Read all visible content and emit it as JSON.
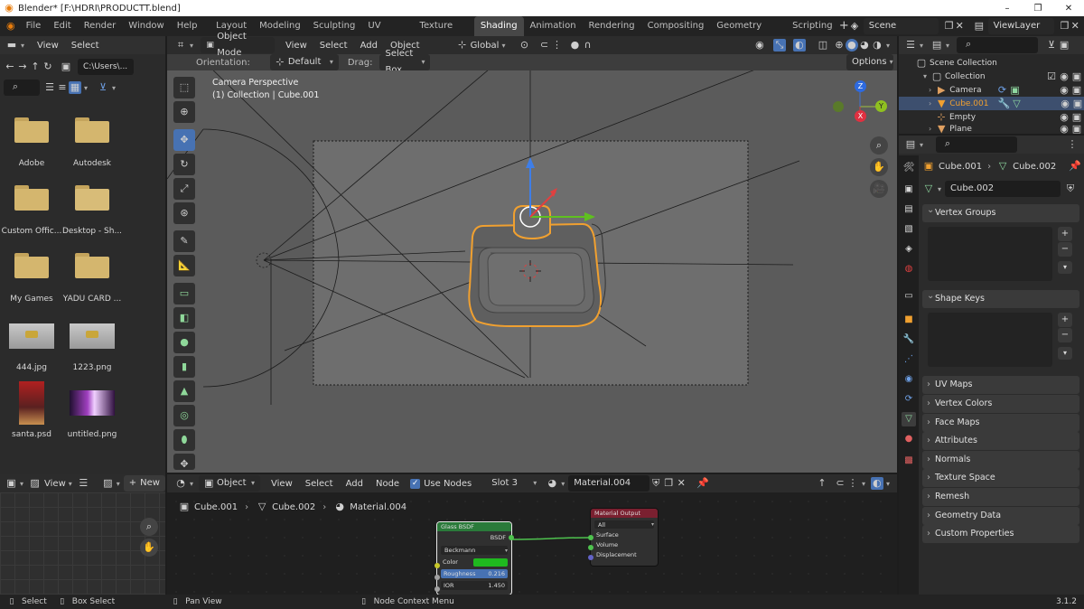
{
  "window": {
    "title": "Blender* [F:\\HDRI\\PRODUCTT.blend]",
    "controls": [
      "–",
      "❐",
      "✕"
    ]
  },
  "menu": [
    "File",
    "Edit",
    "Render",
    "Window",
    "Help"
  ],
  "workspaces": [
    "Layout",
    "Modeling",
    "Sculpting",
    "UV Editing",
    "Texture Paint",
    "Shading",
    "Animation",
    "Rendering",
    "Compositing",
    "Geometry Nodes",
    "Scripting"
  ],
  "active_workspace": "Shading",
  "scene": "Scene",
  "view_layer": "ViewLayer",
  "file_browser": {
    "menu": [
      "View",
      "Select"
    ],
    "path": "C:\\Users\\...",
    "items": [
      {
        "name": "Adobe",
        "type": "folder"
      },
      {
        "name": "Autodesk",
        "type": "folder"
      },
      {
        "name": "Custom Offic...",
        "type": "folder"
      },
      {
        "name": "Desktop - Sh...",
        "type": "folder"
      },
      {
        "name": "My Games",
        "type": "folder"
      },
      {
        "name": "YADU CARD ...",
        "type": "folder"
      },
      {
        "name": "444.jpg",
        "type": "image"
      },
      {
        "name": "1223.png",
        "type": "image"
      },
      {
        "name": "santa.psd",
        "type": "image"
      },
      {
        "name": "untitled.png",
        "type": "image"
      }
    ]
  },
  "viewport": {
    "mode": "Object Mode",
    "menu": [
      "View",
      "Select",
      "Add",
      "Object"
    ],
    "transform": "Global",
    "orientation_label": "Orientation:",
    "orientation_value": "Default",
    "drag_label": "Drag:",
    "drag_value": "Select Box",
    "options": "Options",
    "camera_text": "Camera Perspective",
    "collection_text": "(1) Collection | Cube.001",
    "gizmo": {
      "x": "X",
      "y": "Y",
      "z": "Z"
    }
  },
  "outliner": {
    "title": "Scene Collection",
    "items": [
      {
        "name": "Collection",
        "level": 1
      },
      {
        "name": "Camera",
        "level": 2
      },
      {
        "name": "Cube.001",
        "level": 2,
        "selected": true
      },
      {
        "name": "Empty",
        "level": 2
      },
      {
        "name": "Plane",
        "level": 2
      }
    ]
  },
  "properties": {
    "breadcrumb_obj": "Cube.001",
    "breadcrumb_data": "Cube.002",
    "data_name": "Cube.002",
    "open_panels": [
      "Vertex Groups",
      "Shape Keys"
    ],
    "panels": [
      "UV Maps",
      "Vertex Colors",
      "Face Maps",
      "Attributes",
      "Normals",
      "Texture Space",
      "Remesh",
      "Geometry Data",
      "Custom Properties"
    ]
  },
  "uv_editor": {
    "view": "View",
    "new": "New"
  },
  "node_editor": {
    "type": "Object",
    "menu": [
      "View",
      "Select",
      "Add",
      "Node"
    ],
    "use_nodes": "Use Nodes",
    "slot": "Slot 3",
    "material": "Material.004",
    "breadcrumb": [
      "Cube.001",
      "Cube.002",
      "Material.004"
    ],
    "glass_node": {
      "title": "Glass BSDF",
      "output": "BSDF",
      "distribution": "Beckmann",
      "color_label": "Color",
      "roughness_label": "Roughness",
      "roughness": "0.216",
      "ior_label": "IOR",
      "ior": "1.450"
    },
    "output_node": {
      "title": "Material Output",
      "target": "All",
      "inputs": [
        "Surface",
        "Volume",
        "Displacement"
      ]
    }
  },
  "statusbar": {
    "select": "Select",
    "box_select": "Box Select",
    "pan_view": "Pan View",
    "context_menu": "Node Context Menu",
    "version": "3.1.2"
  },
  "colors": {
    "accent": "#4772b3",
    "selection": "#f0a030",
    "glass_green": "#1fb91f",
    "header": "#2c2c2c"
  }
}
